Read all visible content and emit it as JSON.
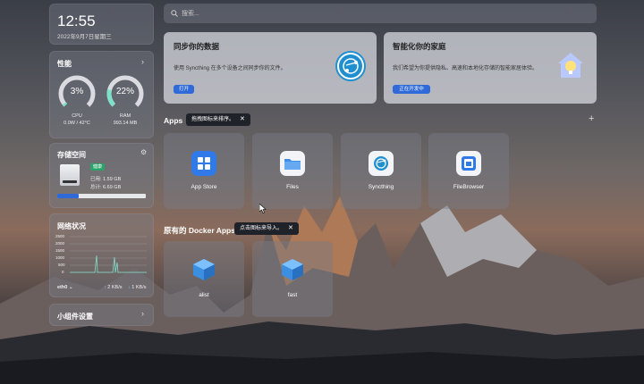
{
  "clock": {
    "time": "12:55",
    "date": "2022年9月7日星期三"
  },
  "performance": {
    "title": "性能",
    "cpu": {
      "value": "3%",
      "label": "CPU",
      "detail": "0.0W / 42°C",
      "fraction": 0.03
    },
    "ram": {
      "value": "22%",
      "label": "RAM",
      "detail": "993.14 MB",
      "fraction": 0.22
    }
  },
  "storage": {
    "title": "存储空间",
    "status": "健康",
    "used": "已用: 1.59 GB",
    "total": "总计: 6.69 GB",
    "fraction": 0.24
  },
  "network": {
    "title": "网络状况",
    "y_ticks": [
      "2500",
      "2000",
      "1500",
      "1000",
      "500",
      "0"
    ],
    "interface": "eth0",
    "upload": "2 KB/s",
    "download": "1 KB/s"
  },
  "widgets": {
    "title": "小组件设置"
  },
  "search": {
    "placeholder": "搜索..."
  },
  "sync_card": {
    "title": "同步你的数据",
    "desc": "使用 Syncthing 在多个设备之间同步你的文件。",
    "button": "打开"
  },
  "home_card": {
    "title": "智能化你的家庭",
    "desc": "我们希望为你提供隐私、高速和本地化存储的智能家居体验。",
    "button": "正在开发中"
  },
  "apps_section": {
    "title": "Apps",
    "tooltip": "拖拽图标来排序。",
    "add": "+",
    "apps": [
      {
        "label": "App Store",
        "icon": "app-store-icon"
      },
      {
        "label": "Files",
        "icon": "folder-icon"
      },
      {
        "label": "Syncthing",
        "icon": "syncthing-icon"
      },
      {
        "label": "FileBrowser",
        "icon": "filebrowser-icon"
      }
    ]
  },
  "docker_section": {
    "title": "原有的 Docker Apps",
    "tooltip": "点击图标来导入。",
    "apps": [
      {
        "label": "alist",
        "icon": "docker-cube-icon"
      },
      {
        "label": "fast",
        "icon": "docker-cube-icon"
      }
    ]
  },
  "colors": {
    "accent": "#2f6ad8",
    "gauge": "#7fe0c8",
    "gauge_track": "#d9dbe0"
  }
}
